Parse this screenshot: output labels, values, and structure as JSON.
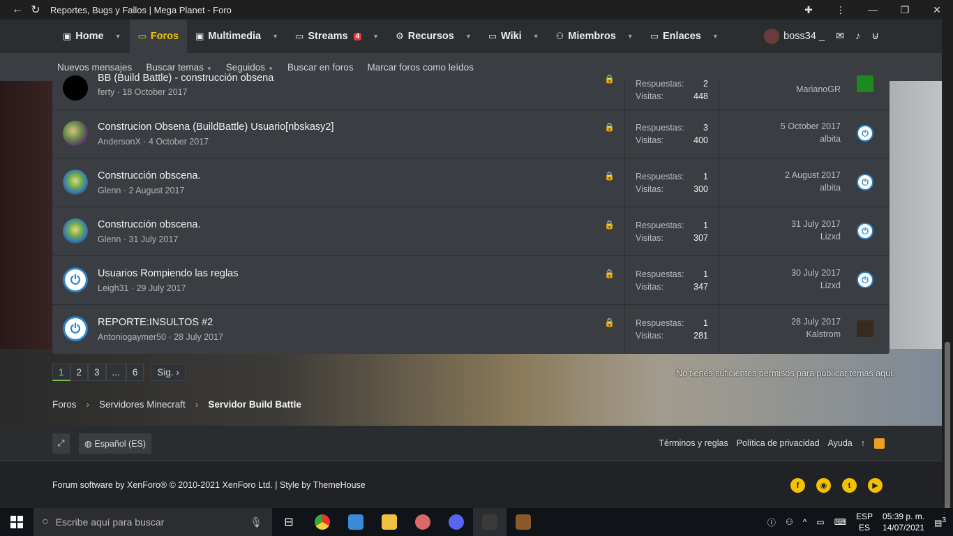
{
  "browser": {
    "title": "Reportes, Bugs y Fallos | Mega Planet - Foro"
  },
  "nav": {
    "items": [
      {
        "label": "Home",
        "icon": "▣"
      },
      {
        "label": "Foros",
        "icon": "▭"
      },
      {
        "label": "Multimedia",
        "icon": "▣"
      },
      {
        "label": "Streams",
        "icon": "▭",
        "badge": "4"
      },
      {
        "label": "Recursos",
        "icon": "⚙"
      },
      {
        "label": "Wiki",
        "icon": "▭"
      },
      {
        "label": "Miembros",
        "icon": "⚇"
      },
      {
        "label": "Enlaces",
        "icon": "▭"
      }
    ],
    "username": "boss34 _"
  },
  "subnav": {
    "items": [
      "Nuevos mensajes",
      "Buscar temas",
      "Seguidos",
      "Buscar en foros",
      "Marcar foros como leídos"
    ]
  },
  "threads": [
    {
      "title": "BB (Build Battle) - construcción obsena",
      "author": "ferty",
      "date": "18 October 2017",
      "replies_label": "Respuestas:",
      "replies": "2",
      "views_label": "Visitas:",
      "views": "448",
      "last_date": "",
      "last_user": "MarianoGR"
    },
    {
      "title": "Construcion Obsena (BuildBattle) Usuario[nbskasy2]",
      "author": "AndersonX",
      "date": "4 October 2017",
      "replies_label": "Respuestas:",
      "replies": "3",
      "views_label": "Visitas:",
      "views": "400",
      "last_date": "5 October 2017",
      "last_user": "albita"
    },
    {
      "title": "Construcción obscena.",
      "author": "Glenn",
      "date": "2 August 2017",
      "replies_label": "Respuestas:",
      "replies": "1",
      "views_label": "Visitas:",
      "views": "300",
      "last_date": "2 August 2017",
      "last_user": "albita"
    },
    {
      "title": "Construcción obscena.",
      "author": "Glenn",
      "date": "31 July 2017",
      "replies_label": "Respuestas:",
      "replies": "1",
      "views_label": "Visitas:",
      "views": "307",
      "last_date": "31 July 2017",
      "last_user": "Lizxd"
    },
    {
      "title": "Usuarios Rompiendo las reglas",
      "author": "Leigh31",
      "date": "29 July 2017",
      "replies_label": "Respuestas:",
      "replies": "1",
      "views_label": "Visitas:",
      "views": "347",
      "last_date": "30 July 2017",
      "last_user": "Lizxd"
    },
    {
      "title": "REPORTE:INSULTOS #2",
      "author": "Antoniogaymer50",
      "date": "28 July 2017",
      "replies_label": "Respuestas:",
      "replies": "1",
      "views_label": "Visitas:",
      "views": "281",
      "last_date": "28 July 2017",
      "last_user": "Kalstrom"
    }
  ],
  "pager": {
    "pages": [
      "1",
      "2",
      "3",
      "...",
      "6"
    ],
    "next": "Sig. ›"
  },
  "no_perm": "No tienes suficientes permisos para publicar temas aquí.",
  "breadcrumb": [
    "Foros",
    "Servidores Minecraft",
    "Servidor Build Battle"
  ],
  "footer": {
    "language": "Español (ES)",
    "links": [
      "Términos y reglas",
      "Política de privacidad",
      "Ayuda"
    ],
    "copyright": "Forum software by XenForo® © 2010-2021 XenForo Ltd. | Style by ThemeHouse"
  },
  "taskbar": {
    "search_placeholder": "Escribe aquí para buscar",
    "lang1": "ESP",
    "lang2": "ES",
    "time": "05:39 p. m.",
    "date": "14/07/2021",
    "notif": "3"
  }
}
